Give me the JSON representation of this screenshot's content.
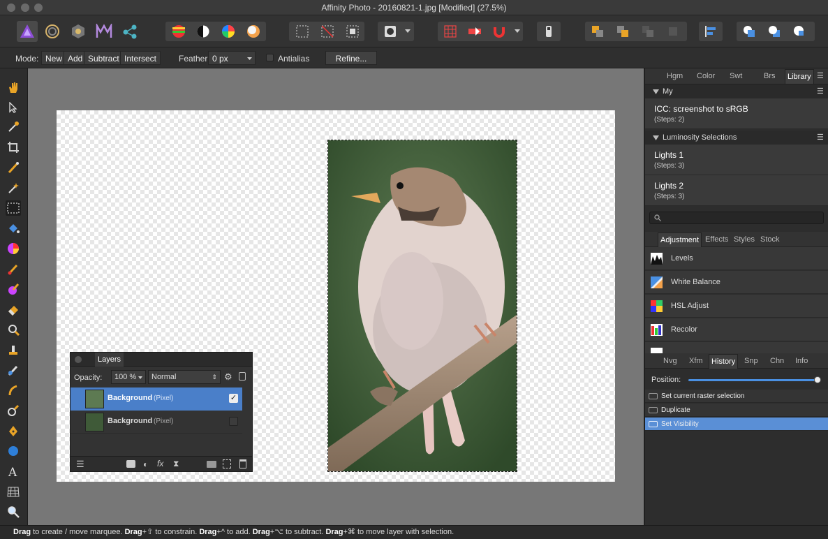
{
  "window": {
    "title": "Affinity Photo - 20160821-1.jpg [Modified] (27.5%)"
  },
  "context_bar": {
    "mode_label": "Mode:",
    "modes": [
      "New",
      "Add",
      "Subtract",
      "Intersect"
    ],
    "feather_label": "Feather:",
    "feather_value": "0 px",
    "antialias_label": "Antialias",
    "refine_label": "Refine..."
  },
  "layers_panel": {
    "title": "Layers",
    "opacity_label": "Opacity:",
    "opacity_value": "100 %",
    "blend_mode": "Normal",
    "layers": [
      {
        "name": "Background",
        "type": "(Pixel)",
        "visible": true,
        "selected": true
      },
      {
        "name": "Background",
        "type": "(Pixel)",
        "visible": false,
        "selected": false
      }
    ]
  },
  "library_panel": {
    "tabs": [
      "Hgm",
      "Color",
      "Swt",
      "Brs",
      "Library"
    ],
    "active_tab": "Library",
    "groups": [
      {
        "name": "My",
        "items": [
          {
            "title": "ICC: screenshot to sRGB",
            "steps": "(Steps: 2)"
          }
        ]
      },
      {
        "name": "Luminosity Selections",
        "items": [
          {
            "title": "Lights 1",
            "steps": "(Steps: 3)"
          },
          {
            "title": "Lights 2",
            "steps": "(Steps: 3)"
          }
        ]
      }
    ]
  },
  "adjustment_panel": {
    "tabs": [
      "Adjustment",
      "Effects",
      "Styles",
      "Stock"
    ],
    "active_tab": "Adjustment",
    "items": [
      "Levels",
      "White Balance",
      "HSL Adjust",
      "Recolor"
    ]
  },
  "history_panel": {
    "tabs": [
      "Nvg",
      "Xfm",
      "History",
      "Snp",
      "Chn",
      "Info"
    ],
    "active_tab": "History",
    "position_label": "Position:",
    "position_value": 1.0,
    "entries": [
      "Set current raster selection",
      "Duplicate",
      "Set Visibility"
    ],
    "selected_index": 2
  },
  "status_bar": {
    "parts": [
      {
        "b": "Drag",
        "t": " to create / move marquee. "
      },
      {
        "b": "Drag",
        "t": "+⇧ to constrain. "
      },
      {
        "b": "Drag",
        "t": "+^ to add. "
      },
      {
        "b": "Drag",
        "t": "+⌥ to subtract. "
      },
      {
        "b": "Drag",
        "t": "+⌘ to move layer with selection."
      }
    ]
  }
}
